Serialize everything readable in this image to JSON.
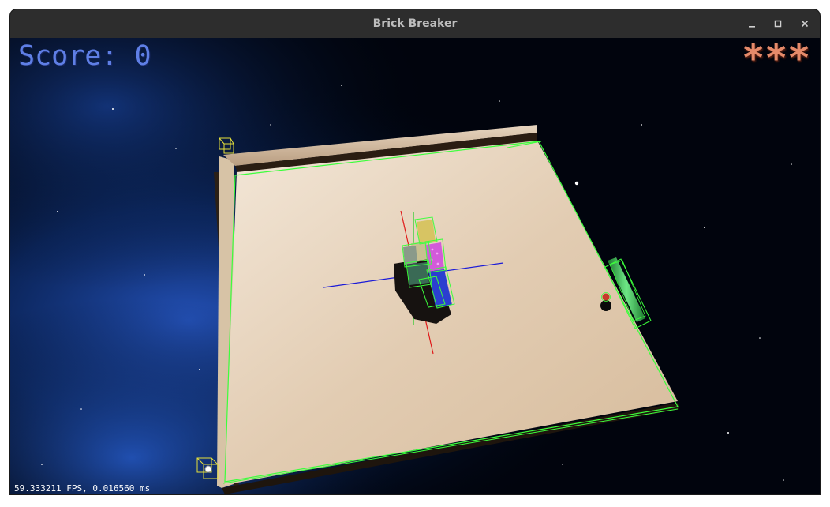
{
  "window": {
    "title": "Brick Breaker",
    "controls": [
      "minimize-icon",
      "maximize-icon",
      "close-icon"
    ]
  },
  "hud": {
    "score_label": "Score: 0",
    "lives_display": "***",
    "fps_readout": "59.333211 FPS, 0.016560 ms"
  },
  "colors": {
    "score_text": "#5f7fe6",
    "lives_text": "#e58a6a",
    "debug_box": "#3cff3c",
    "paddle": "#2fb34a",
    "board": "#e4cfb6",
    "brick_yellow": "#d7c463",
    "brick_pink": "#d25ad9",
    "brick_blue": "#2b3fd0",
    "brick_gray": "#8a9a8a"
  }
}
